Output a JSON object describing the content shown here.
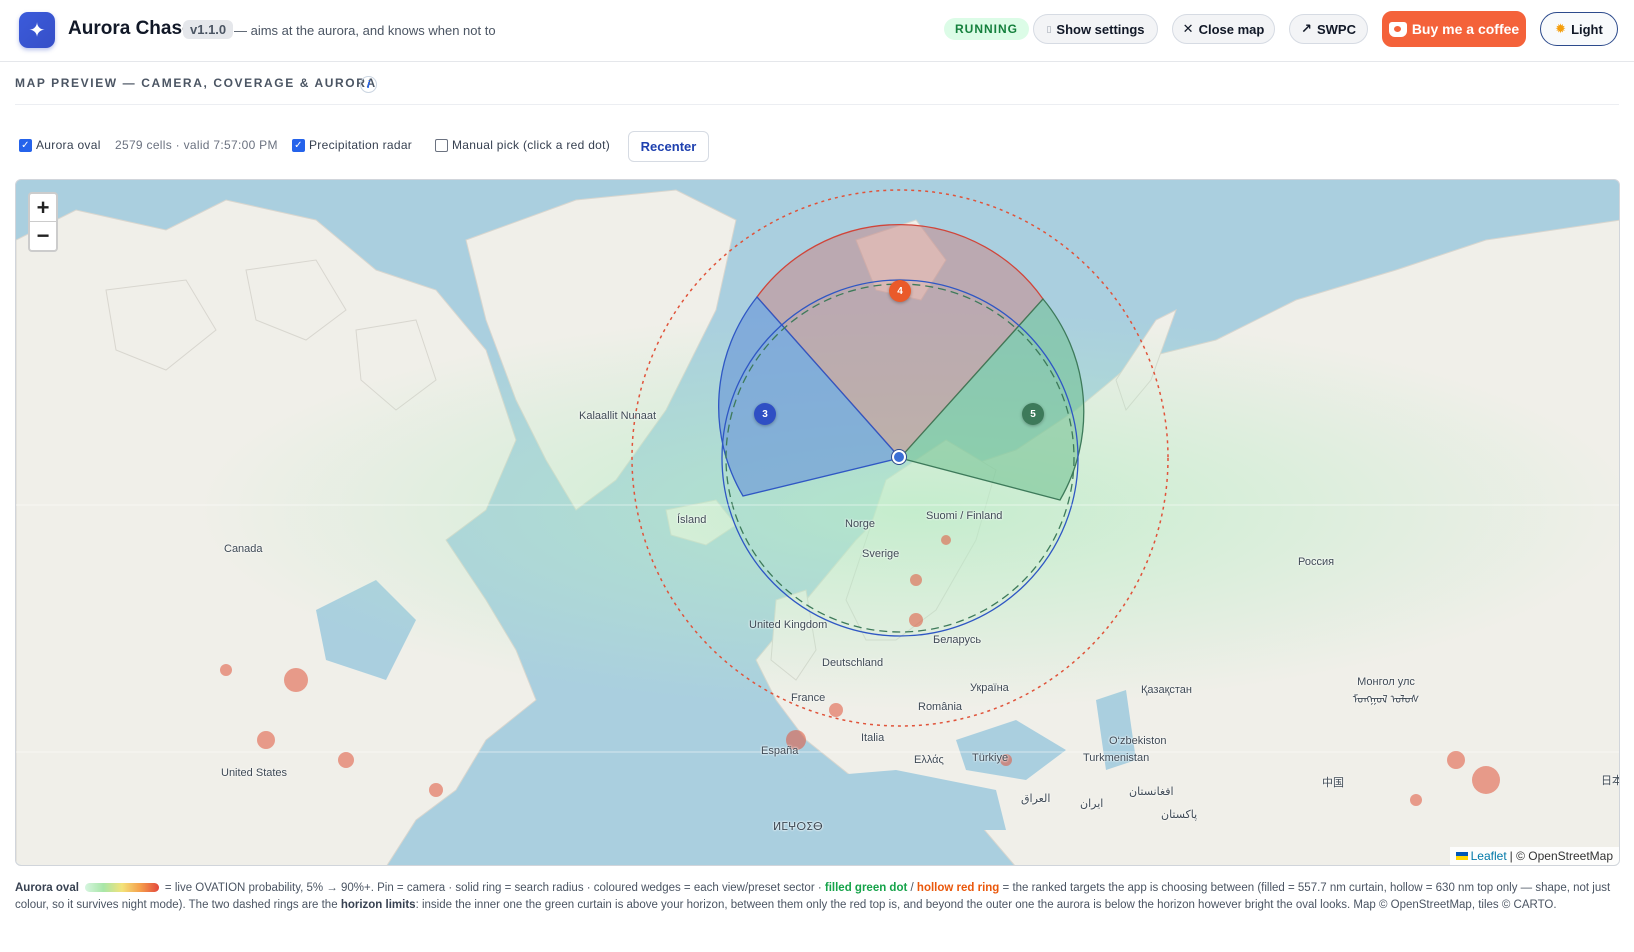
{
  "header": {
    "title": "Aurora Chaser",
    "version": "v1.1.0",
    "tagline": "— aims at the aurora, and knows when not to",
    "status": "RUNNING",
    "buttons": {
      "settings": "Show settings",
      "close_map": "Close map",
      "swpc": "SWPC",
      "coffee": "Buy me a coffee",
      "theme": "Light"
    }
  },
  "section": {
    "title": "MAP PREVIEW — CAMERA, COVERAGE & AURORA",
    "info": "i"
  },
  "controls": {
    "aurora_oval": {
      "label": "Aurora oval",
      "checked": true
    },
    "oval_info": "2579 cells · valid 7:57:00 PM",
    "precip_radar": {
      "label": "Precipitation radar",
      "checked": true
    },
    "manual_pick": {
      "label": "Manual pick (click a red dot)",
      "checked": false
    },
    "recenter": "Recenter"
  },
  "map": {
    "zoom_in": "+",
    "zoom_out": "−",
    "labels": {
      "greenland": "Kalaallit Nunaat",
      "canada": "Canada",
      "iceland": "Ísland",
      "norway": "Norge",
      "finland": "Suomi / Finland",
      "sweden": "Sverige",
      "uk": "United Kingdom",
      "belarus": "Беларусь",
      "germany": "Deutschland",
      "france": "France",
      "ukraine": "Україна",
      "romania": "România",
      "kazakhstan": "Қазақстан",
      "mongolia": "Монгол улс ᠮᠣᠩᠭᠣᠯ ᠤᠯᠤᠰ",
      "russia": "Россия",
      "usa": "United States",
      "spain": "España",
      "italy": "Italia",
      "greece": "Ελλάς",
      "turkey": "Türkiye",
      "uzbekistan": "O‘zbekiston",
      "turkmenistan": "Turkmenistan",
      "iraq": "العراق",
      "iran": "ایران",
      "afghanistan": "افغانستان",
      "pakistan": "پاکستان",
      "china": "中国",
      "japan": "日本",
      "morocco": "ⵍⵎⵖⵔⵉⴱ"
    },
    "markers": [
      {
        "id": "4",
        "color": "#ea5a2a"
      },
      {
        "id": "3",
        "color": "#2f4fc4"
      },
      {
        "id": "5",
        "color": "#3d7a5a"
      }
    ],
    "attribution": {
      "leaflet": "Leaflet",
      "osm": "| © OpenStreetMap"
    }
  },
  "legend": {
    "label": "Aurora oval",
    "text1": "= live OVATION probability, 5% → 90%+. Pin = camera · solid ring = search radius · coloured wedges = each view/preset sector ·",
    "green": "filled green dot",
    "sep": "/",
    "red": "hollow red ring",
    "text2": "= the ranked targets the app is choosing between (filled = 557.7 nm curtain, hollow = 630 nm top only — shape, not just colour, so it survives night mode). The two dashed rings are the",
    "horizon": "horizon limits",
    "text3": ": inside the inner one the green curtain is above your horizon, between them only the red top is, and beyond the outer one the aurora is below the horizon however bright the oval looks. Map © OpenStreetMap, tiles © CARTO."
  },
  "colors": {
    "accent": "#2563eb",
    "running": "#15803d",
    "coffee": "#f4623a",
    "ocean": "#aacfdf",
    "land": "#f0efe9"
  }
}
